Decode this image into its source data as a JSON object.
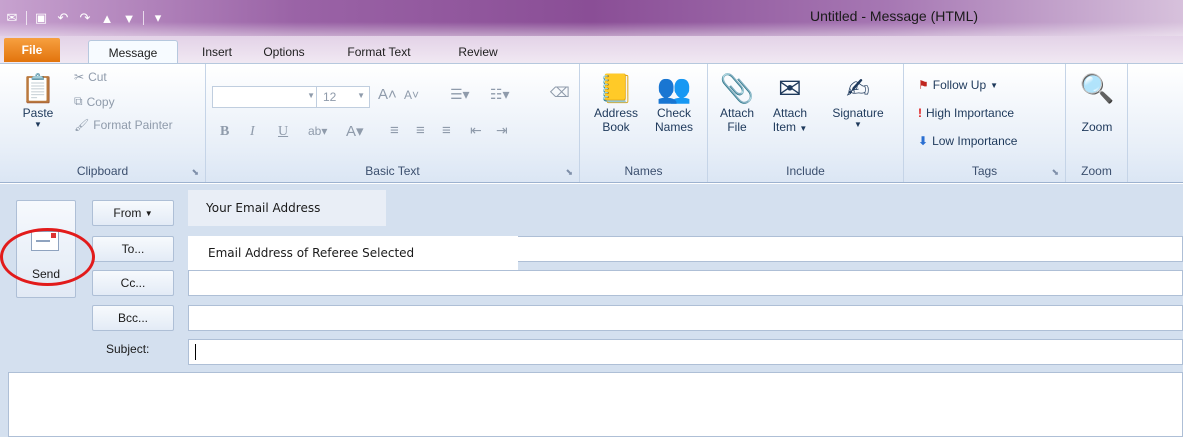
{
  "window": {
    "title": "Untitled - Message (HTML)"
  },
  "tabs": [
    {
      "label": "File"
    },
    {
      "label": "Message"
    },
    {
      "label": "Insert"
    },
    {
      "label": "Options"
    },
    {
      "label": "Format Text"
    },
    {
      "label": "Review"
    }
  ],
  "clipboard": {
    "paste": "Paste",
    "cut": "Cut",
    "copy": "Copy",
    "format_painter": "Format Painter",
    "label": "Clipboard"
  },
  "basic_text": {
    "font_size": "12",
    "label": "Basic Text"
  },
  "names": {
    "address_book_line1": "Address",
    "address_book_line2": "Book",
    "check_names_line1": "Check",
    "check_names_line2": "Names",
    "label": "Names"
  },
  "include": {
    "attach_file_line1": "Attach",
    "attach_file_line2": "File",
    "attach_item_line1": "Attach",
    "attach_item_line2": "Item",
    "signature": "Signature",
    "label": "Include"
  },
  "tags": {
    "follow_up": "Follow Up",
    "high_importance": "High Importance",
    "low_importance": "Low Importance",
    "label": "Tags"
  },
  "zoom": {
    "button": "Zoom",
    "label": "Zoom"
  },
  "compose": {
    "send": "Send",
    "from_button": "From",
    "to_button": "To...",
    "cc_button": "Cc...",
    "bcc_button": "Bcc...",
    "subject_label": "Subject:",
    "from_value": "Your Email Address",
    "to_value": "Email Address of Referee Selected"
  }
}
